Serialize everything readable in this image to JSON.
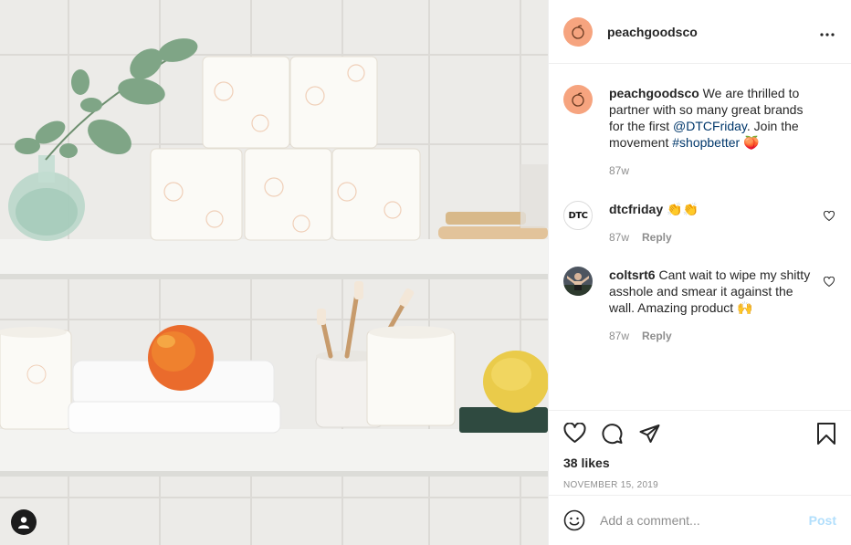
{
  "colors": {
    "brand_peach": "#f6a47f",
    "link": "#00376b",
    "muted": "#8e8e8e",
    "post_button_disabled": "#b2dffc"
  },
  "post": {
    "author": "peachgoodsco",
    "more_icon": "more-horizontal-icon"
  },
  "comments": [
    {
      "username": "peachgoodsco",
      "text_before": " We are thrilled to partner with so many great brands for the first ",
      "mention": "@DTCFriday",
      "text_middle": ". Join the movement ",
      "hashtag": "#shopbetter",
      "emoji": " 🍑",
      "time": "87w"
    },
    {
      "username": "dtcfriday",
      "avatar_text": "DTC",
      "text": " 👏👏",
      "time": "87w",
      "reply_label": "Reply"
    },
    {
      "username": "coltsrt6",
      "text": " Cant wait to wipe my shitty asshole and smear it against the wall. Amazing product 🙌",
      "time": "87w",
      "reply_label": "Reply"
    }
  ],
  "actions": {
    "like_icon": "heart-icon",
    "comment_icon": "comment-icon",
    "share_icon": "share-icon",
    "save_icon": "bookmark-icon"
  },
  "likes": "38 likes",
  "date": "November 15, 2019",
  "add_comment": {
    "placeholder": "Add a comment...",
    "post_label": "Post"
  }
}
